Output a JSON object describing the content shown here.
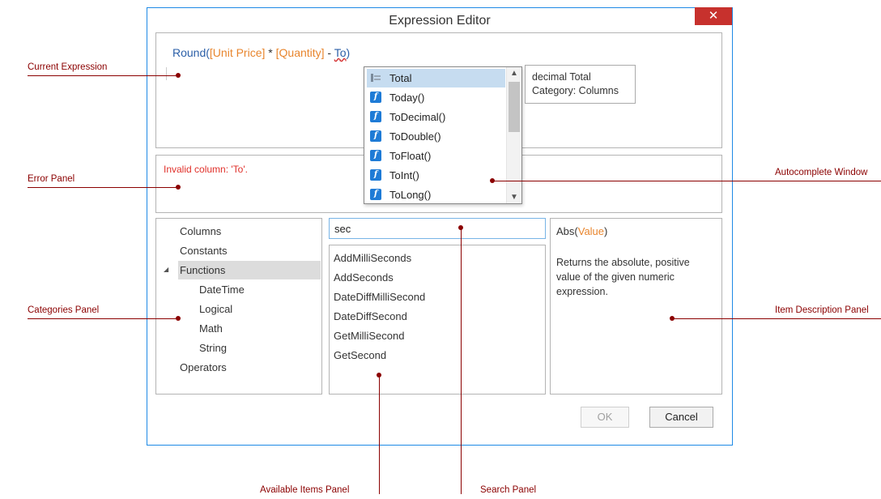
{
  "window": {
    "title": "Expression Editor",
    "close_glyph": "✕"
  },
  "expression": {
    "fn": "Round(",
    "col1": "[Unit Price]",
    "op1": " * ",
    "col2": "[Quantity]",
    "op2": " - ",
    "err": "To",
    "close": ")"
  },
  "error": {
    "message": "Invalid column: 'To'."
  },
  "categories": {
    "items": [
      "Columns",
      "Constants",
      "Functions",
      "DateTime",
      "Logical",
      "Math",
      "String",
      "Operators"
    ],
    "selected": "Functions"
  },
  "search": {
    "value": "sec"
  },
  "available_items": [
    "AddMilliSeconds",
    "AddSeconds",
    "DateDiffMilliSecond",
    "DateDiffSecond",
    "GetMilliSecond",
    "GetSecond"
  ],
  "description": {
    "name": "Abs(",
    "param": "Value",
    "close": ")",
    "text": "Returns the absolute, positive value of the given numeric expression."
  },
  "buttons": {
    "ok": "OK",
    "cancel": "Cancel"
  },
  "autocomplete": {
    "items": [
      {
        "label": "Total",
        "icon": "column-icon"
      },
      {
        "label": "Today()",
        "icon": "function-icon"
      },
      {
        "label": "ToDecimal()",
        "icon": "function-icon"
      },
      {
        "label": "ToDouble()",
        "icon": "function-icon"
      },
      {
        "label": "ToFloat()",
        "icon": "function-icon"
      },
      {
        "label": "ToInt()",
        "icon": "function-icon"
      },
      {
        "label": "ToLong()",
        "icon": "function-icon"
      }
    ],
    "selected": "Total",
    "function_glyph": "f",
    "tooltip_line1": "decimal Total",
    "tooltip_line2": "Category: Columns"
  },
  "callouts": {
    "current_expression": "Current Expression",
    "error_panel": "Error Panel",
    "categories_panel": "Categories Panel",
    "autocomplete_window": "Autocomplete Window",
    "item_description_panel": "Item Description Panel",
    "available_items_panel": "Available Items Panel",
    "search_panel": "Search Panel"
  },
  "colors": {
    "accent": "#1e8ae6",
    "callout": "#8b0000",
    "close_bg": "#c7312d",
    "column_token": "#e8852d",
    "function_token": "#2b5fa8",
    "error_text": "#e0302a"
  }
}
